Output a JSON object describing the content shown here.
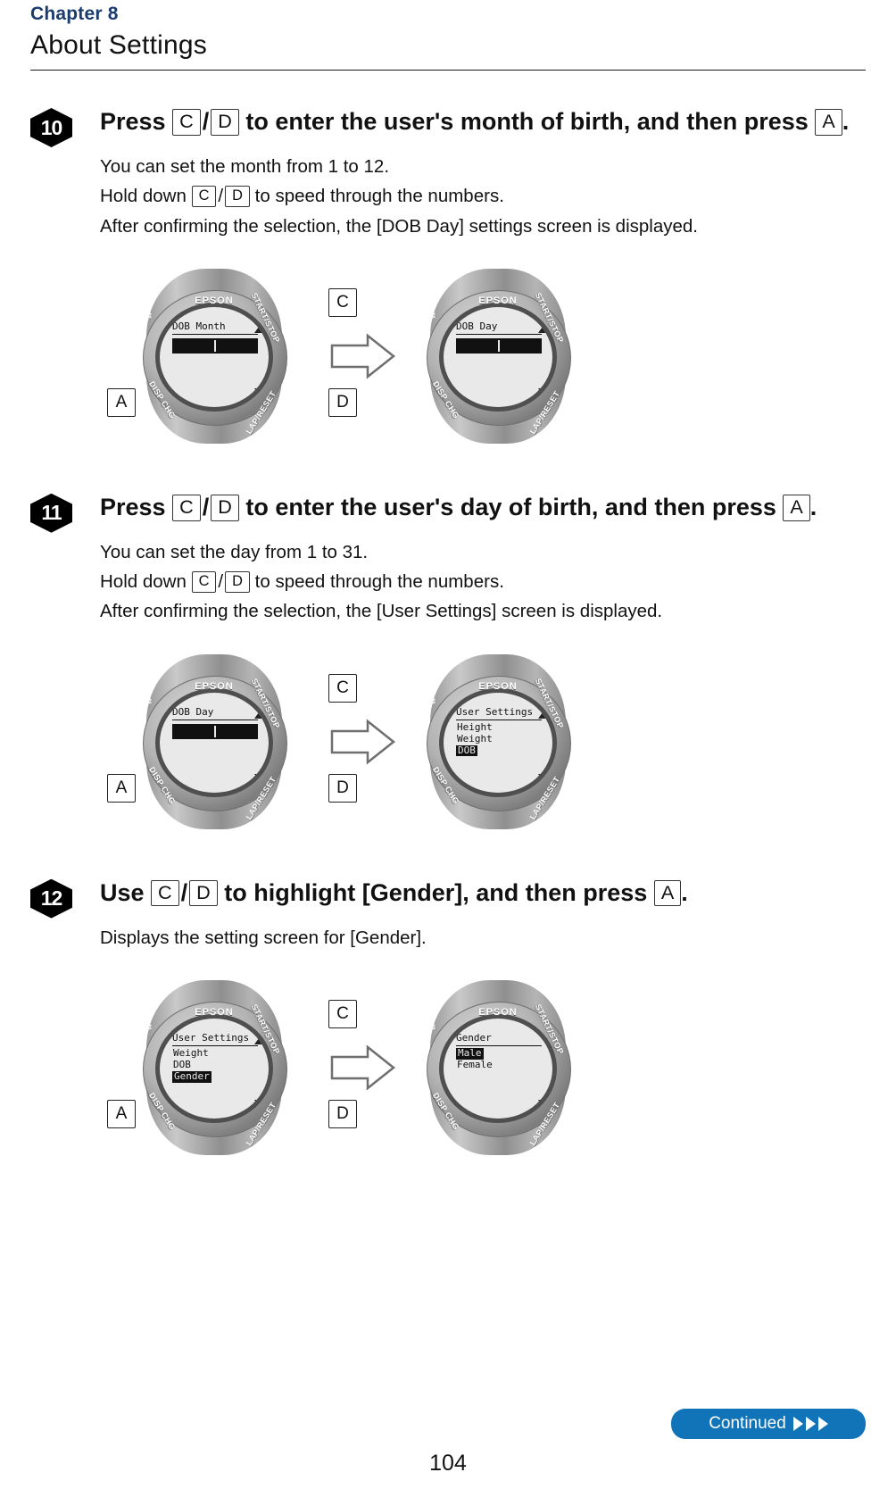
{
  "header": {
    "chapter": "Chapter 8",
    "title": "About Settings"
  },
  "keys": {
    "a": "A",
    "c": "C",
    "d": "D",
    "slash": "/"
  },
  "steps": [
    {
      "number": "10",
      "title_pre": "Press",
      "title_mid": "to enter the user's month of birth, and then press",
      "title_end": ".",
      "desc": [
        "You can set the month from 1 to 12.",
        "Hold down",
        "to speed through the numbers.",
        "After confirming the selection, the [DOB Day] settings screen is displayed."
      ],
      "watch_left": {
        "brand": "EPSON",
        "lcd_title": "DOB Month",
        "lcd_type": "value",
        "labels": {
          "start_stop": "START/STOP",
          "lap_reset": "LAP/RESET",
          "disp_chg": "DISP CHG"
        }
      },
      "watch_right": {
        "brand": "EPSON",
        "lcd_title": "DOB Day",
        "lcd_type": "value",
        "labels": {
          "start_stop": "START/STOP",
          "lap_reset": "LAP/RESET",
          "disp_chg": "DISP CHG"
        }
      },
      "callouts": {
        "c": "C",
        "d": "D",
        "a": "A"
      }
    },
    {
      "number": "11",
      "title_pre": "Press",
      "title_mid": "to enter the user's day of birth, and then press",
      "title_end": ".",
      "desc": [
        "You can set the day from 1 to 31.",
        "Hold down",
        "to speed through the numbers.",
        "After confirming the selection, the [User Settings] screen is displayed."
      ],
      "watch_left": {
        "brand": "EPSON",
        "lcd_title": "DOB Day",
        "lcd_type": "value",
        "labels": {
          "start_stop": "START/STOP",
          "lap_reset": "LAP/RESET",
          "disp_chg": "DISP CHG"
        }
      },
      "watch_right": {
        "brand": "EPSON",
        "lcd_title": "User Settings",
        "lcd_type": "list",
        "rows": [
          "Height",
          "Weight",
          "DOB"
        ],
        "selected": "DOB",
        "labels": {
          "start_stop": "START/STOP",
          "lap_reset": "LAP/RESET",
          "disp_chg": "DISP CHG"
        }
      },
      "callouts": {
        "c": "C",
        "d": "D",
        "a": "A"
      }
    },
    {
      "number": "12",
      "title_pre": "Use",
      "title_mid": "to highlight [Gender], and then press",
      "title_end": ".",
      "desc": [
        "Displays the setting screen for [Gender]."
      ],
      "watch_left": {
        "brand": "EPSON",
        "lcd_title": "User Settings",
        "lcd_type": "list",
        "rows": [
          "Weight",
          "DOB",
          "Gender"
        ],
        "selected": "Gender",
        "labels": {
          "start_stop": "START/STOP",
          "lap_reset": "LAP/RESET",
          "disp_chg": "DISP CHG"
        }
      },
      "watch_right": {
        "brand": "EPSON",
        "lcd_title": "Gender",
        "lcd_type": "list",
        "rows": [
          "Male",
          "Female"
        ],
        "selected": "Male",
        "labels": {
          "start_stop": "START/STOP",
          "lap_reset": "LAP/RESET",
          "disp_chg": "DISP CHG"
        }
      },
      "callouts": {
        "c": "C",
        "d": "D",
        "a": "A"
      }
    }
  ],
  "footer": {
    "continued_label": "Continued",
    "page_number": "104"
  },
  "colors": {
    "chapter_blue": "#1b3d6e",
    "continued_blue": "#1173b8"
  }
}
